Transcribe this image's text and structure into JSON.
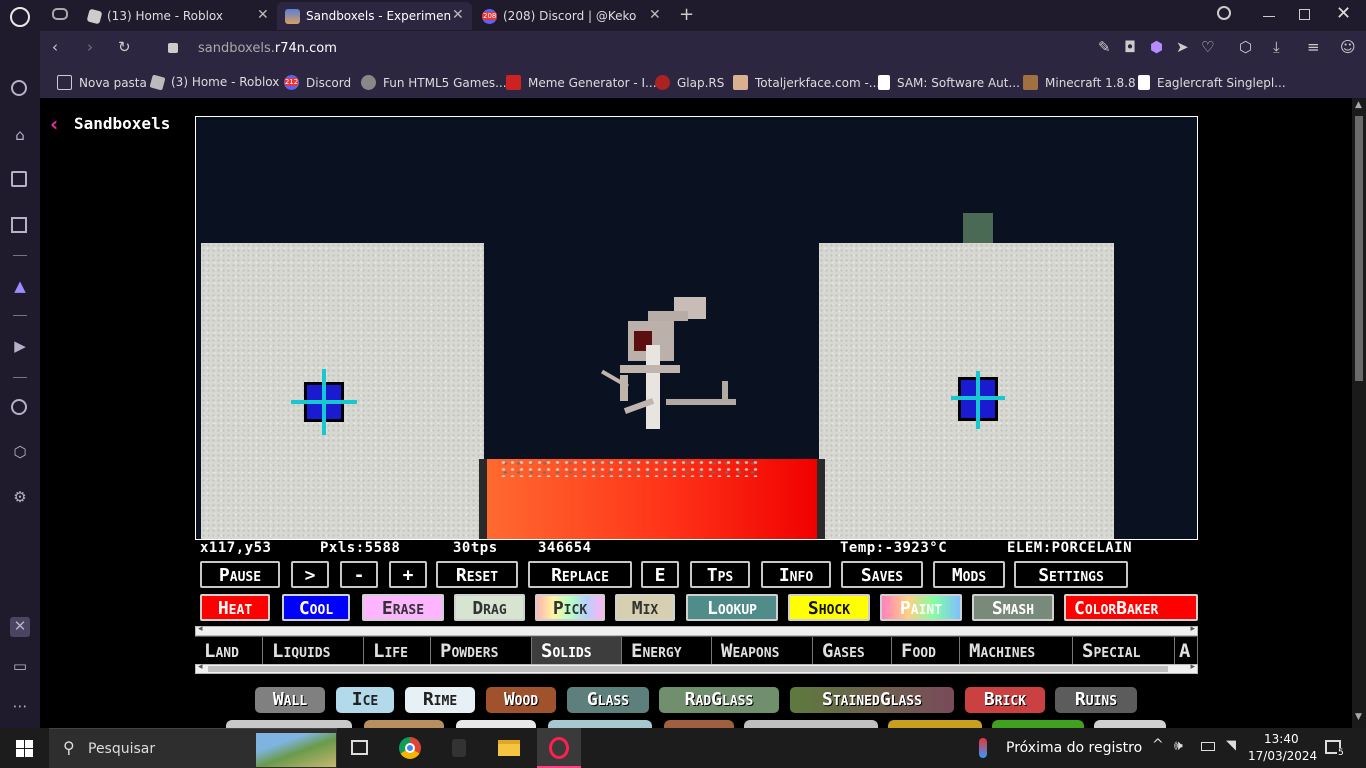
{
  "tabs": [
    {
      "title": "(13) Home - Roblox",
      "active": false
    },
    {
      "title": "Sandboxels - Experiment w",
      "active": true
    },
    {
      "title": "(208) Discord | @Keko",
      "active": false
    }
  ],
  "address": {
    "domain_prefix": "sandboxels.",
    "domain_main": "r74n.com"
  },
  "bookmarks": [
    "Nova pasta",
    "(3) Home - Roblox",
    "Discord",
    "Fun HTML5 Games...",
    "Meme Generator - I...",
    "Glap.RS",
    "Totaljerkface.com -...",
    "SAM: Software Aut...",
    "Minecraft 1.8.8",
    "Eaglercraft Singlepl..."
  ],
  "discord_badge": "212",
  "tab_discord_badge": "208",
  "page_title": "Sandboxels",
  "stats": {
    "coords": "x117,y53",
    "pixels": "Pxls:5588",
    "tps": "30tps",
    "ticks": "346654",
    "temp": "Temp:-3923°C",
    "elem": "ELEM:PORCELAIN"
  },
  "controls": [
    "Pause",
    ">",
    "-",
    "+",
    "Reset",
    "Replace",
    "E",
    "Tps",
    "Info",
    "Saves",
    "Mods",
    "Settings"
  ],
  "tools": [
    {
      "label": "Heat",
      "color": "#ff0000"
    },
    {
      "label": "Cool",
      "color": "#0000ff"
    },
    {
      "label": "Erase",
      "color": "#fdb5ff"
    },
    {
      "label": "Drag",
      "color": "#d8e4d2"
    },
    {
      "label": "Pick",
      "color": "#ffb5e5"
    },
    {
      "label": "Mix",
      "color": "#d6cfb0"
    },
    {
      "label": "Lookup",
      "color": "#4f8c8a"
    },
    {
      "label": "Shock",
      "color": "#ffff00"
    },
    {
      "label": "Paint",
      "color": "#ff80c0"
    },
    {
      "label": "Smash",
      "color": "#7a8a7a"
    },
    {
      "label": "ColorBaker",
      "color": "#ff0000"
    }
  ],
  "categories": [
    "Land",
    "Liquids",
    "Life",
    "Powders",
    "Solids",
    "Energy",
    "Weapons",
    "Gases",
    "Food",
    "Machines",
    "Special",
    "A"
  ],
  "selected_category": "Solids",
  "elements": [
    {
      "label": "Wall",
      "color": "#808080"
    },
    {
      "label": "Ice",
      "color": "#b2daeb"
    },
    {
      "label": "Rime",
      "color": "#e6f0f5"
    },
    {
      "label": "Wood",
      "color": "#a0522d"
    },
    {
      "label": "Glass",
      "color": "#5e807d"
    },
    {
      "label": "RadGlass",
      "color": "#6f8f6d"
    },
    {
      "label": "StainedGlass",
      "color": "#6b5a3e"
    },
    {
      "label": "Brick",
      "color": "#cb4141"
    },
    {
      "label": "Ruins",
      "color": "#5c5c5c"
    }
  ],
  "taskbar": {
    "search": "Pesquisar",
    "weather": "Próxima do registro",
    "time": "13:40",
    "date": "17/03/2024",
    "notif": "5"
  }
}
